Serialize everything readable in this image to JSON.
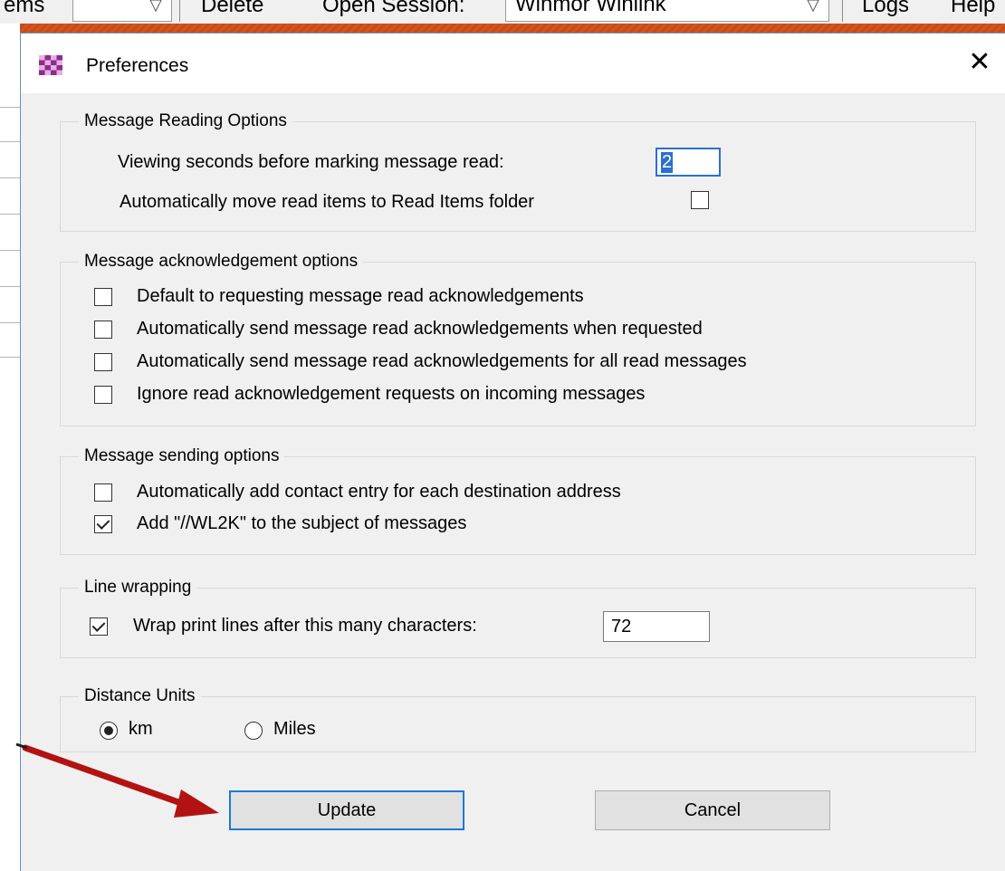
{
  "background_app": {
    "toolbar": {
      "items_partial": "ems",
      "delete": "Delete",
      "open_session": "Open Session:",
      "session_type": "Winmor Winlink",
      "logs": "Logs",
      "help_partial": "Help"
    }
  },
  "dialog": {
    "title": "Preferences",
    "close_glyph": "✕",
    "reading": {
      "legend": "Message Reading Options",
      "seconds_label": "Viewing seconds before marking message read:",
      "seconds_value": "2",
      "move_label": "Automatically move read items to Read Items folder",
      "move_checked": false
    },
    "ack": {
      "legend": "Message acknowledgement options",
      "items": [
        {
          "label": "Default to requesting message read acknowledgements",
          "checked": false
        },
        {
          "label": "Automatically send message read acknowledgements when requested",
          "checked": false
        },
        {
          "label": "Automatically send message read acknowledgements for all read messages",
          "checked": false
        },
        {
          "label": "Ignore read acknowledgement requests on incoming messages",
          "checked": false
        }
      ]
    },
    "sending": {
      "legend": "Message sending options",
      "items": [
        {
          "label": "Automatically add contact entry for each destination address",
          "checked": false
        },
        {
          "label": "Add \"//WL2K\" to the subject of messages",
          "checked": true
        }
      ]
    },
    "wrap": {
      "legend": "Line wrapping",
      "label": "Wrap print lines after this many characters:",
      "checked": true,
      "value": "72"
    },
    "distance": {
      "legend": "Distance Units",
      "options": [
        {
          "label": "km",
          "selected": true
        },
        {
          "label": "Miles",
          "selected": false
        }
      ]
    },
    "buttons": {
      "update": "Update",
      "cancel": "Cancel"
    }
  },
  "colors": {
    "annotation_arrow": "#b31212",
    "default_button_border": "#1c79d6",
    "background": "#c84a18"
  }
}
